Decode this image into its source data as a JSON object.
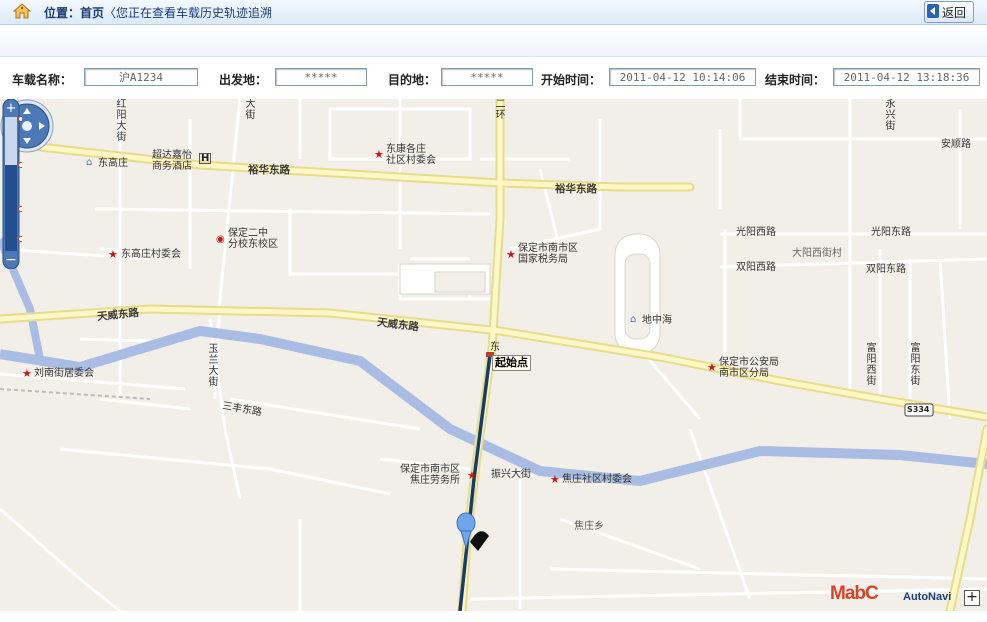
{
  "header": {
    "location_label": "位置：首页",
    "breadcrumb_text": "〈您正在查看车载历史轨迹追溯",
    "back_label": "返回"
  },
  "filters": {
    "vehicle_name_label": "车载名称：",
    "vehicle_name_value": "沪A1234",
    "origin_label": "出发地：",
    "origin_value": "*****",
    "destination_label": "目的地：",
    "destination_value": "*****",
    "start_time_label": "开始时间：",
    "start_time_value": "2011-04-12 10:14:06",
    "end_time_label": "结束时间：",
    "end_time_value": "2011-04-12 13:18:36"
  },
  "map": {
    "start_point_label": "起始点",
    "logo_left": "MabC",
    "logo_right": "AutoNavi",
    "expand_symbol": "+",
    "shield": "S334",
    "roads": {
      "yuhua_w": "裕华东路",
      "yuhua_e": "裕华东路",
      "tianwei_w": "天威东路",
      "tianwei_e": "天威东路",
      "guangyang_w": "光阳西路",
      "guangyang_e": "光阳东路",
      "shuangyang_w": "双阳西路",
      "shuangyang_e": "双阳东路",
      "anshun": "安顺路",
      "sanfeng": "三丰东路",
      "zhenxing": "振兴大街",
      "dayangxi": "大阳西街村",
      "hongyang": "红阳大街",
      "dajie": "大街",
      "erhuan": "二环",
      "yonxing": "永兴街",
      "yulan": "玉兰大街",
      "fuyangxi": "富阳西街",
      "fuyangdong": "富阳东街",
      "dong": "东"
    },
    "pois": {
      "dongkang": "东康各庄\n社区村委会",
      "chaoda": "超达嘉怡\n商务酒店",
      "donggaozhuang": "东高庄",
      "baoding2": "保定二中\n分校东校区",
      "donggaocun": "东高庄村委会",
      "guoshui": "保定市南市区\n国家税务局",
      "dizhonghai": "地中海",
      "gongan": "保定市公安局\n南市区分局",
      "liunan": "刘南街居委会",
      "jiaozhuang_labor": "保定市南市区\n焦庄劳务所",
      "jiaozhuang_committee": "焦庄社区村委会",
      "jiaozhuang_xiang": "焦庄乡"
    }
  }
}
